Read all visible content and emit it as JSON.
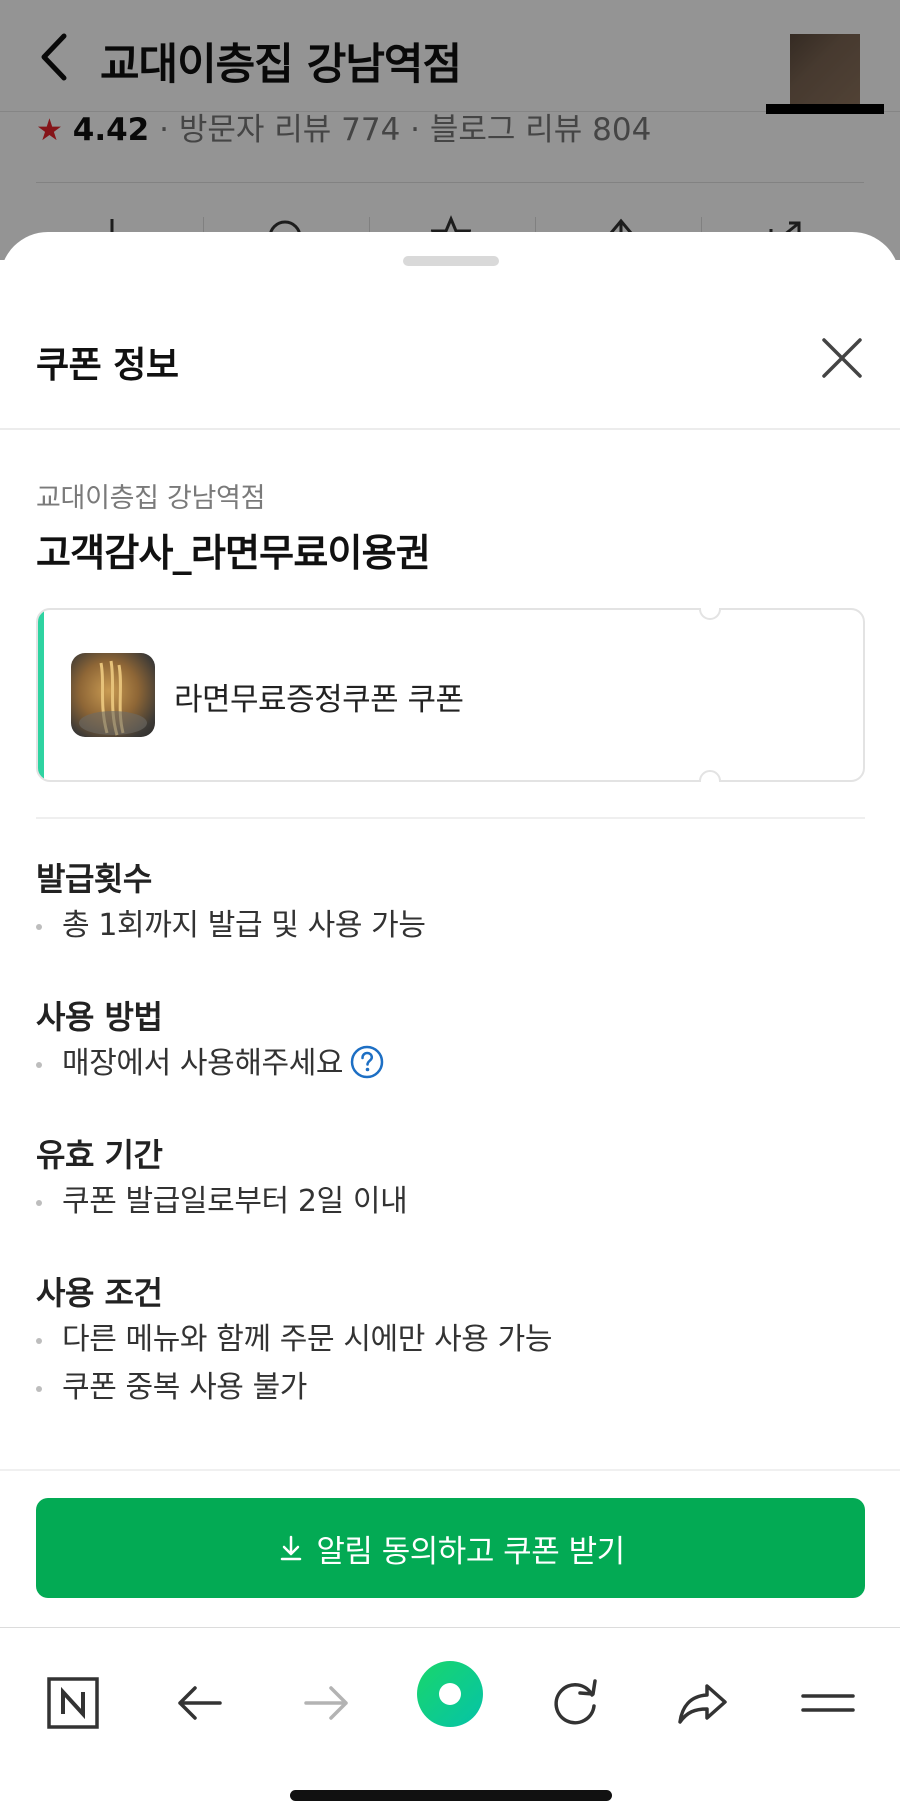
{
  "background_page": {
    "title": "교대이층집 강남역점",
    "rating_star": "★",
    "rating_score": "4.42",
    "rating_detail": "· 방문자 리뷰 774 · 블로그 리뷰 804"
  },
  "sheet": {
    "title": "쿠폰 정보",
    "store_name": "교대이층집 강남역점",
    "coupon_title": "고객감사_라면무료이용권",
    "ticket_label": "라면무료증정쿠폰 쿠폰",
    "sections": {
      "issue_count": {
        "heading": "발급횟수",
        "items": [
          "총 1회까지 발급 및 사용 가능"
        ]
      },
      "usage_method": {
        "heading": "사용 방법",
        "items": [
          "매장에서 사용해주세요"
        ]
      },
      "validity": {
        "heading": "유효 기간",
        "items": [
          "쿠폰 발급일로부터 2일 이내"
        ]
      },
      "conditions": {
        "heading": "사용 조건",
        "items": [
          "다른 메뉴와 함께 주문 시에만 사용 가능",
          "쿠폰 중복 사용 불가"
        ]
      }
    },
    "cta_label": "알림 동의하고 쿠폰 받기"
  },
  "colors": {
    "accent_green": "#03aa54",
    "ticket_stripe": "#2ed3a1",
    "help_blue": "#1d6fc4",
    "star_red": "#e5242b"
  },
  "icons": {
    "back": "chevron-left-icon",
    "close": "close-icon",
    "help": "question-circle-icon",
    "download": "download-icon",
    "naver": "naver-n-icon",
    "nav_back": "arrow-left-icon",
    "nav_forward": "arrow-right-icon",
    "green_dot": "green-dot-icon",
    "reload": "reload-icon",
    "share": "share-icon",
    "menu": "menu-icon"
  }
}
